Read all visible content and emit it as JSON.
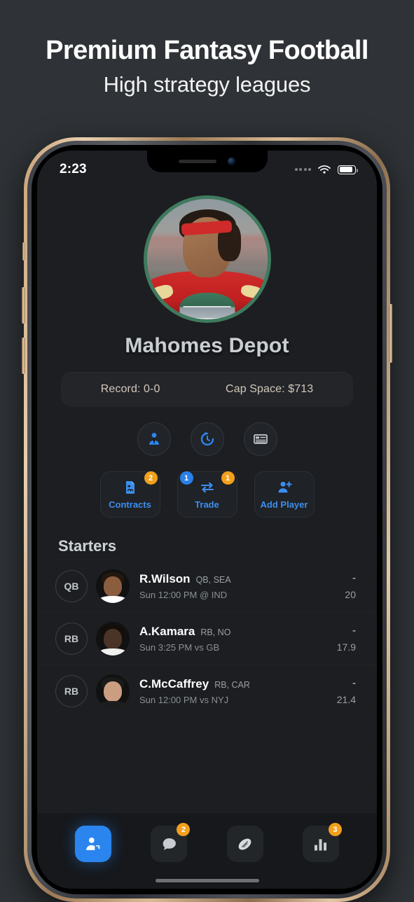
{
  "promo": {
    "title": "Premium Fantasy Football",
    "subtitle": "High strategy leagues"
  },
  "status_bar": {
    "time": "2:23",
    "signal_icon": "signal-dots-icon",
    "wifi_icon": "wifi-icon",
    "battery_icon": "battery-icon"
  },
  "team": {
    "avatar_name": "team-avatar",
    "name": "Mahomes Depot",
    "record": "Record: 0-0",
    "cap_space": "Cap Space: $713"
  },
  "quick_actions": [
    {
      "name": "roster-icon",
      "icon": "person-tie-icon",
      "color": "#2b85ef"
    },
    {
      "name": "history-icon",
      "icon": "history-clock-icon",
      "color": "#2b85ef"
    },
    {
      "name": "standings-icon",
      "icon": "table-list-icon",
      "color": "#c8ccd0"
    }
  ],
  "action_cards": [
    {
      "label": "Contracts",
      "icon": "contract-document-icon",
      "badge_right": "2",
      "badge_right_color": "#f2a01c",
      "badge_left": null
    },
    {
      "label": "Trade",
      "icon": "trade-arrows-icon",
      "badge_left": "1",
      "badge_left_color": "#2b7fe8",
      "badge_right": "1",
      "badge_right_color": "#f2a01c"
    },
    {
      "label": "Add Player",
      "icon": "add-person-icon",
      "badge_left": null,
      "badge_right": null
    }
  ],
  "roster": {
    "section_title": "Starters",
    "players": [
      {
        "position": "QB",
        "name": "R.Wilson",
        "meta": "QB, SEA",
        "game": "Sun 12:00 PM @ IND",
        "score": "-",
        "projection": "20",
        "skin": "#8a5d3f",
        "hair": "#23170f",
        "jersey": "#ffffff"
      },
      {
        "position": "RB",
        "name": "A.Kamara",
        "meta": "RB, NO",
        "game": "Sun 3:25 PM vs GB",
        "score": "-",
        "projection": "17.9",
        "skin": "#4a3426",
        "hair": "#140d09",
        "jersey": "#f0f0f0"
      },
      {
        "position": "RB",
        "name": "C.McCaffrey",
        "meta": "RB, CAR",
        "game": "Sun 12:00 PM vs NYJ",
        "score": "-",
        "projection": "21.4",
        "skin": "#cb9e82",
        "hair": "#1a1a1a",
        "jersey": "#1d1d1d"
      }
    ]
  },
  "tabs": [
    {
      "name": "tab-team",
      "icon": "person-tag-icon",
      "active": true,
      "badge": null
    },
    {
      "name": "tab-messages",
      "icon": "chat-bubble-icon",
      "active": false,
      "badge": "2"
    },
    {
      "name": "tab-league",
      "icon": "football-icon",
      "active": false,
      "badge": null
    },
    {
      "name": "tab-stats",
      "icon": "bar-chart-icon",
      "active": false,
      "badge": "3"
    }
  ],
  "colors": {
    "accent_blue": "#2b85ef",
    "badge_orange": "#f2a01c",
    "screen_bg": "#1c1e21",
    "page_bg": "#2f3337",
    "frame_gold": "#c9a177"
  }
}
